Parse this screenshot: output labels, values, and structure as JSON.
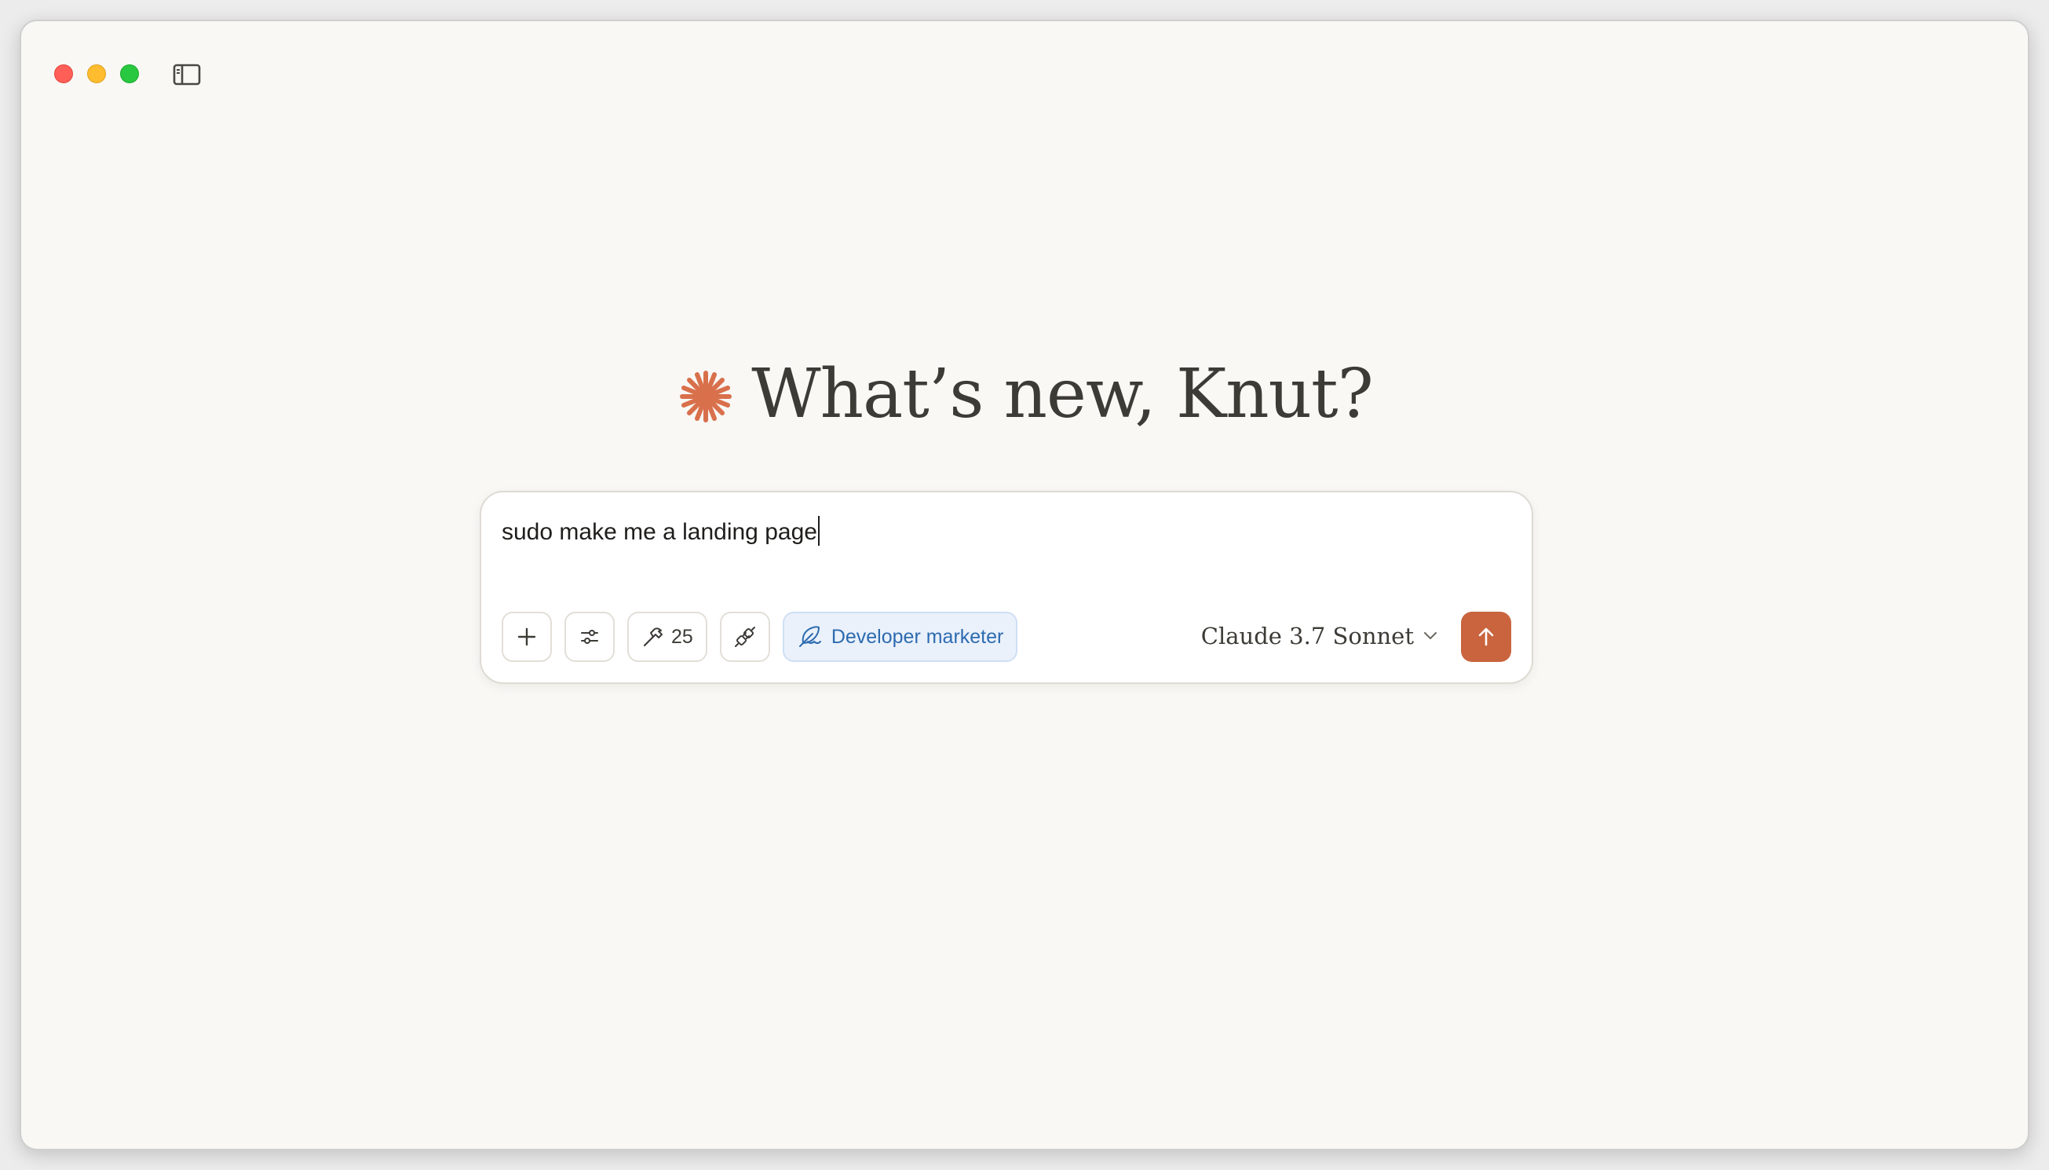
{
  "window": {
    "controls": [
      "close",
      "minimize",
      "zoom"
    ]
  },
  "greeting": {
    "text": "What’s new, Knut?",
    "icon": "claude-starburst-icon",
    "icon_color": "#d9704c"
  },
  "composer": {
    "input_value": "sudo make me a landing page",
    "tools_count": "25",
    "style_label": "Developer marketer",
    "model_label": "Claude 3.7 Sonnet",
    "send_color": "#c9643e"
  },
  "icons": {
    "add": "plus-icon",
    "settings": "sliders-icon",
    "tools": "hammer-icon",
    "integrations": "plug-icon",
    "style": "feather-icon",
    "model": "chevron-down-icon",
    "send": "arrow-up-icon",
    "sidebar": "sidebar-icon"
  }
}
